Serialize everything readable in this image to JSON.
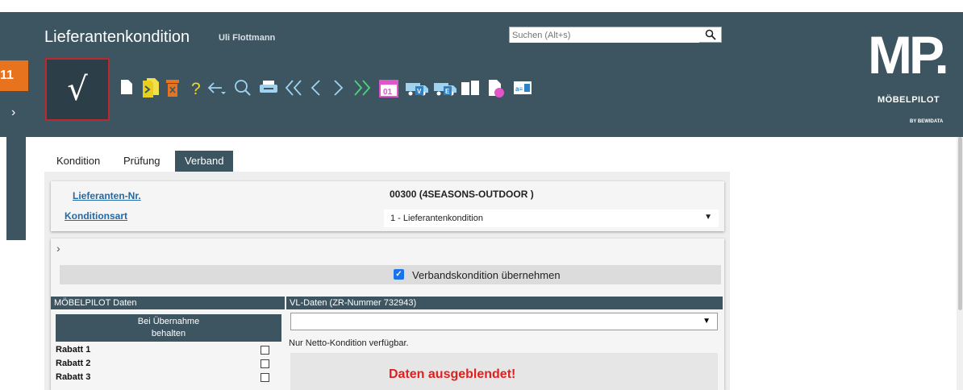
{
  "header": {
    "title": "Lieferantenkondition",
    "user": "Uli Flottmann",
    "search_placeholder": "Suchen (Alt+s)"
  },
  "logo": {
    "mark": "MP.",
    "name": "MÖBELPILOT",
    "by": "BY BEWIDATA"
  },
  "step_badge": "11",
  "check_button": {
    "glyph": "√"
  },
  "toolbar_icons": [
    "new-document-icon",
    "copy-document-icon",
    "delete-bin-icon",
    "help-question-icon",
    "back-arrow-icon",
    "search-magnifier-icon",
    "print-icon",
    "first-record-icon",
    "previous-record-icon",
    "next-record-icon",
    "last-record-icon",
    "calendar-icon",
    "truck-v-icon",
    "truck-e-icon",
    "book-icon",
    "document-pink-icon",
    "id-card-icon"
  ],
  "tabs": [
    {
      "label": "Kondition",
      "active": false
    },
    {
      "label": "Prüfung",
      "active": false
    },
    {
      "label": "Verband",
      "active": true
    }
  ],
  "panel1": {
    "lieferanten_label": "Lieferanten-Nr.",
    "lieferanten_value": "00300 (4SEASONS-OUTDOOR )",
    "konditionsart_label": "Konditionsart",
    "konditionsart_value": "1 - Lieferantenkondition"
  },
  "panel2": {
    "verband_checked": true,
    "verband_label": "Verbandskondition übernehmen",
    "left_section_title": "MÖBELPILOT Daten",
    "right_section_title": "VL-Daten (ZR-Nummer 732943)",
    "col_head_line1": "Bei Übernahme",
    "col_head_line2": "behalten",
    "rows": [
      "Rabatt 1",
      "Rabatt 2",
      "Rabatt 3"
    ],
    "netto_note": "Nur Netto-Kondition verfügbar.",
    "hidden_message": "Daten ausgeblendet!"
  },
  "colors": {
    "header_bg": "#3d5561",
    "accent_orange": "#e8731f",
    "alert_red": "#e02020",
    "link_blue": "#2368a6"
  }
}
